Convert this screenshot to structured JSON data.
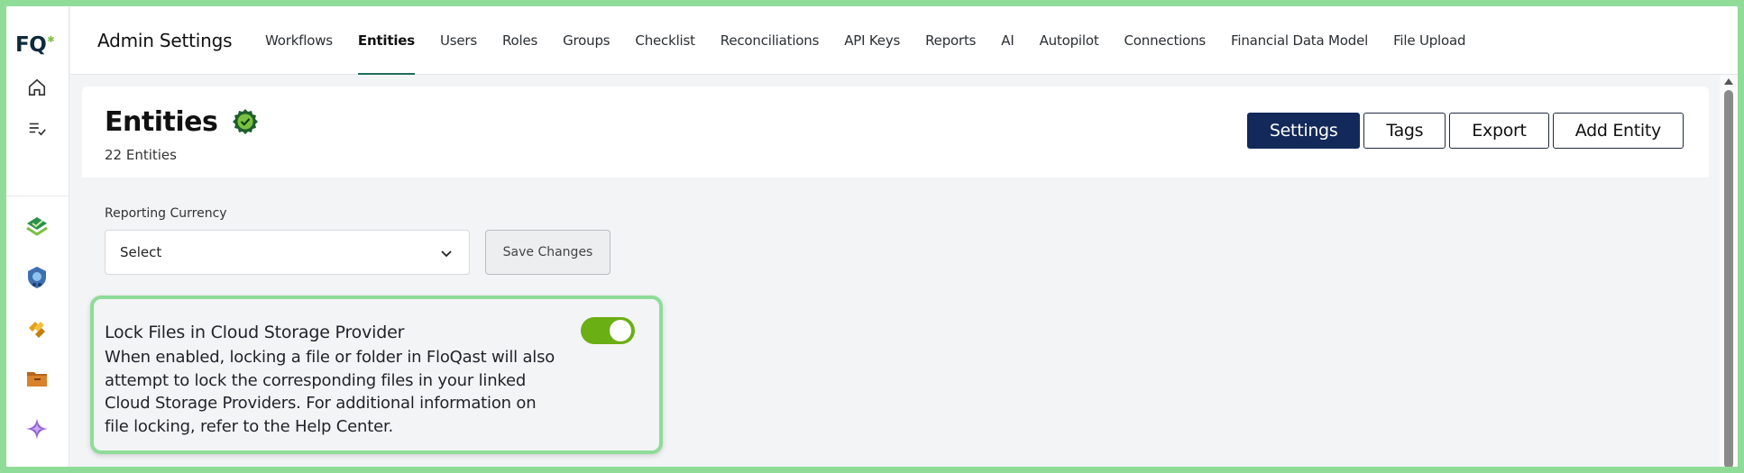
{
  "rail": {
    "logo_text": "FQ",
    "items": [
      {
        "icon": "home-icon"
      },
      {
        "icon": "checklist-icon"
      },
      {
        "icon": "green-check-stack-icon"
      },
      {
        "icon": "blue-shield-icon"
      },
      {
        "icon": "gold-link-icon"
      },
      {
        "icon": "folder-icon"
      },
      {
        "icon": "purple-sparkle-icon"
      }
    ]
  },
  "topnav": {
    "brand": "Admin Settings",
    "items": [
      {
        "label": "Workflows"
      },
      {
        "label": "Entities",
        "active": true
      },
      {
        "label": "Users"
      },
      {
        "label": "Roles"
      },
      {
        "label": "Groups"
      },
      {
        "label": "Checklist"
      },
      {
        "label": "Reconciliations"
      },
      {
        "label": "API Keys"
      },
      {
        "label": "Reports"
      },
      {
        "label": "AI"
      },
      {
        "label": "Autopilot"
      },
      {
        "label": "Connections"
      },
      {
        "label": "Financial Data Model"
      },
      {
        "label": "File Upload"
      }
    ]
  },
  "header": {
    "title": "Entities",
    "subtitle": "22 Entities",
    "buttons": {
      "settings": "Settings",
      "tags": "Tags",
      "export": "Export",
      "add_entity": "Add Entity"
    }
  },
  "reporting": {
    "label": "Reporting Currency",
    "select_value": "Select",
    "save_label": "Save Changes"
  },
  "lock_files": {
    "title": "Lock Files in Cloud Storage Provider",
    "description": "When enabled, locking a file or folder in FloQast will also attempt to lock the corresponding files in your linked Cloud Storage Providers. For additional information on file locking, refer to the Help Center.",
    "enabled": true
  },
  "colors": {
    "accent_nav": "#12295a",
    "toggle_on": "#6aaf14",
    "highlight": "#8fdc98"
  }
}
